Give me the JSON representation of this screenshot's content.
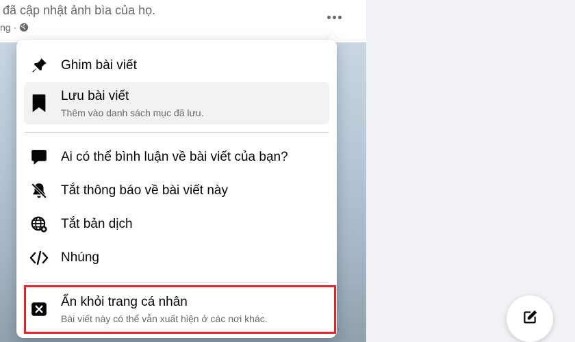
{
  "post": {
    "header_text": "đã cập nhật ảnh bìa của họ.",
    "meta_text": "ng ·"
  },
  "menu": {
    "items": [
      {
        "label": "Ghim bài viết",
        "icon": "pin-icon"
      },
      {
        "label": "Lưu bài viết",
        "sub": "Thêm vào danh sách mục đã lưu.",
        "icon": "bookmark-icon"
      },
      {
        "label": "Ai có thể bình luận về bài viết của bạn?",
        "icon": "comment-icon"
      },
      {
        "label": "Tắt thông báo về bài viết này",
        "icon": "bell-off-icon"
      },
      {
        "label": "Tắt bản dịch",
        "icon": "translate-globe-icon"
      },
      {
        "label": "Nhúng",
        "icon": "code-icon"
      },
      {
        "label": "Ẩn khỏi trang cá nhân",
        "sub": "Bài viết này có thể vẫn xuất hiện ở các nơi khác.",
        "icon": "hide-x-icon"
      }
    ]
  },
  "colors": {
    "highlight": "#e02626",
    "icon": "#050505",
    "secondary_text": "#65676b"
  }
}
